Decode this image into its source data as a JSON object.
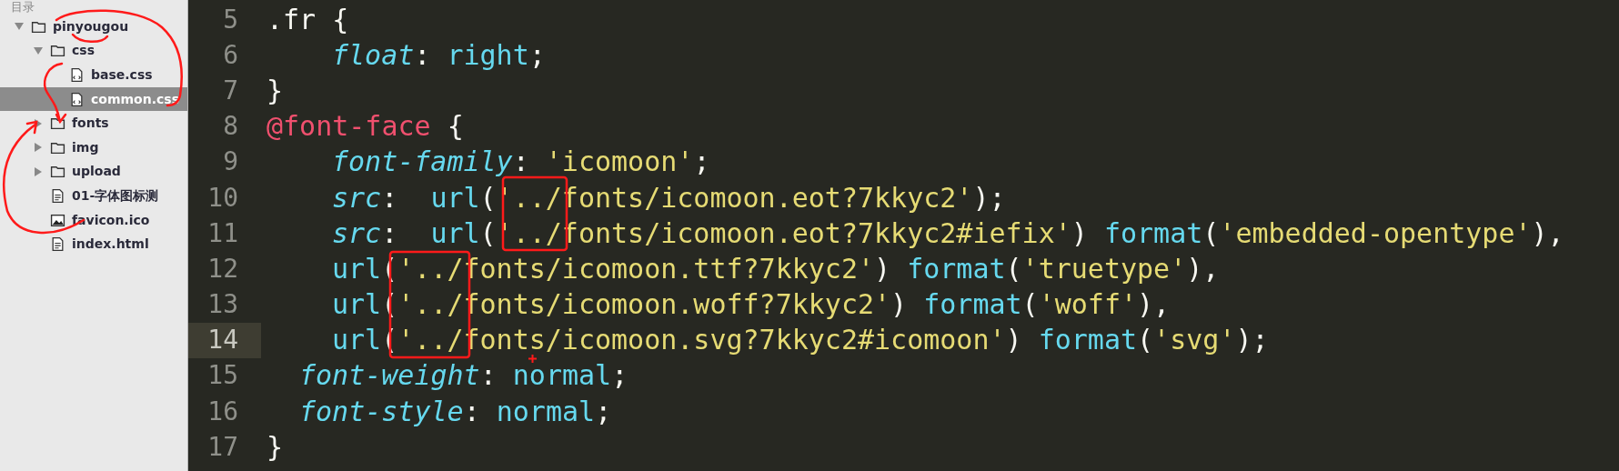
{
  "sidebar": {
    "header": "目录",
    "tree": [
      {
        "label": "pinyougou",
        "kind": "folder",
        "expanded": true,
        "selected": false,
        "children": [
          {
            "label": "css",
            "kind": "folder",
            "expanded": true,
            "selected": false,
            "children": [
              {
                "label": "base.css",
                "kind": "code",
                "selected": false
              },
              {
                "label": "common.css",
                "kind": "code",
                "selected": true
              }
            ]
          },
          {
            "label": "fonts",
            "kind": "folder",
            "expanded": false,
            "selected": false
          },
          {
            "label": "img",
            "kind": "folder",
            "expanded": false,
            "selected": false
          },
          {
            "label": "upload",
            "kind": "folder",
            "expanded": false,
            "selected": false
          },
          {
            "label": "01-字体图标测",
            "kind": "doc",
            "selected": false
          },
          {
            "label": "favicon.ico",
            "kind": "image",
            "selected": false
          },
          {
            "label": "index.html",
            "kind": "doc",
            "selected": false
          }
        ]
      }
    ]
  },
  "editor": {
    "lines": [
      {
        "number": "5",
        "current": false,
        "kind": "top",
        "tokens": [
          {
            "text": ".fr {",
            "kind": "plain"
          }
        ]
      },
      {
        "number": "6",
        "current": false,
        "kind": "nested",
        "tokens": [
          {
            "text": "float",
            "kind": "property"
          },
          {
            "text": ": ",
            "kind": "plain"
          },
          {
            "text": "right",
            "kind": "value"
          },
          {
            "text": ";",
            "kind": "plain"
          }
        ]
      },
      {
        "number": "7",
        "current": false,
        "kind": "top",
        "tokens": [
          {
            "text": "}",
            "kind": "plain"
          }
        ]
      },
      {
        "number": "8",
        "current": false,
        "kind": "top",
        "tokens": [
          {
            "text": "@font-face",
            "kind": "atrule"
          },
          {
            "text": " {",
            "kind": "plain"
          }
        ]
      },
      {
        "number": "9",
        "current": false,
        "kind": "nested",
        "tokens": [
          {
            "text": "font-family",
            "kind": "property"
          },
          {
            "text": ": ",
            "kind": "plain"
          },
          {
            "text": "'icomoon'",
            "kind": "string"
          },
          {
            "text": ";",
            "kind": "plain"
          }
        ]
      },
      {
        "number": "10",
        "current": false,
        "kind": "nested",
        "tokens": [
          {
            "text": "src",
            "kind": "property"
          },
          {
            "text": ":  ",
            "kind": "plain"
          },
          {
            "text": "url",
            "kind": "func"
          },
          {
            "text": "(",
            "kind": "plain"
          },
          {
            "text": "'../fonts/icomoon.eot?7kkyc2'",
            "kind": "string"
          },
          {
            "text": ");",
            "kind": "plain"
          }
        ]
      },
      {
        "number": "11",
        "current": false,
        "kind": "nested",
        "tokens": [
          {
            "text": "src",
            "kind": "property"
          },
          {
            "text": ":  ",
            "kind": "plain"
          },
          {
            "text": "url",
            "kind": "func"
          },
          {
            "text": "(",
            "kind": "plain"
          },
          {
            "text": "'../fonts/icomoon.eot?7kkyc2#iefix'",
            "kind": "string"
          },
          {
            "text": ") ",
            "kind": "plain"
          },
          {
            "text": "format",
            "kind": "func"
          },
          {
            "text": "(",
            "kind": "plain"
          },
          {
            "text": "'embedded-opentype'",
            "kind": "string"
          },
          {
            "text": "),",
            "kind": "plain"
          }
        ]
      },
      {
        "number": "12",
        "current": false,
        "kind": "nested",
        "tokens": [
          {
            "text": "url",
            "kind": "func"
          },
          {
            "text": "(",
            "kind": "plain"
          },
          {
            "text": "'../fonts/icomoon.ttf?7kkyc2'",
            "kind": "string"
          },
          {
            "text": ") ",
            "kind": "plain"
          },
          {
            "text": "format",
            "kind": "func"
          },
          {
            "text": "(",
            "kind": "plain"
          },
          {
            "text": "'truetype'",
            "kind": "string"
          },
          {
            "text": "),",
            "kind": "plain"
          }
        ]
      },
      {
        "number": "13",
        "current": false,
        "kind": "nested",
        "tokens": [
          {
            "text": "url",
            "kind": "func"
          },
          {
            "text": "(",
            "kind": "plain"
          },
          {
            "text": "'../fonts/icomoon.woff?7kkyc2'",
            "kind": "string"
          },
          {
            "text": ") ",
            "kind": "plain"
          },
          {
            "text": "format",
            "kind": "func"
          },
          {
            "text": "(",
            "kind": "plain"
          },
          {
            "text": "'woff'",
            "kind": "string"
          },
          {
            "text": "),",
            "kind": "plain"
          }
        ]
      },
      {
        "number": "14",
        "current": true,
        "kind": "nested",
        "tokens": [
          {
            "text": "url",
            "kind": "func"
          },
          {
            "text": "(",
            "kind": "plain"
          },
          {
            "text": "'../fonts/icomoon.svg?7kkyc2#icomoon'",
            "kind": "string"
          },
          {
            "text": ") ",
            "kind": "plain"
          },
          {
            "text": "format",
            "kind": "func"
          },
          {
            "text": "(",
            "kind": "plain"
          },
          {
            "text": "'svg'",
            "kind": "string"
          },
          {
            "text": ");",
            "kind": "plain"
          }
        ]
      },
      {
        "number": "15",
        "current": false,
        "kind": "offset",
        "tokens": [
          {
            "text": "font-weight",
            "kind": "property"
          },
          {
            "text": ": ",
            "kind": "plain"
          },
          {
            "text": "normal",
            "kind": "value"
          },
          {
            "text": ";",
            "kind": "plain"
          }
        ]
      },
      {
        "number": "16",
        "current": false,
        "kind": "offset",
        "tokens": [
          {
            "text": "font-style",
            "kind": "property"
          },
          {
            "text": ": ",
            "kind": "plain"
          },
          {
            "text": "normal",
            "kind": "value"
          },
          {
            "text": ";",
            "kind": "plain"
          }
        ]
      },
      {
        "number": "17",
        "current": false,
        "kind": "top",
        "tokens": [
          {
            "text": "}",
            "kind": "plain"
          }
        ]
      }
    ]
  }
}
